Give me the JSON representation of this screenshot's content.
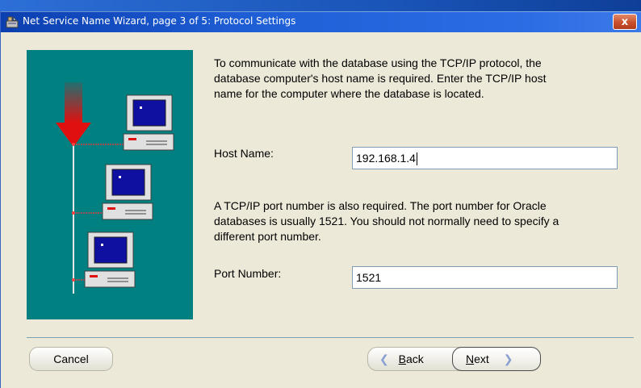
{
  "window": {
    "title": "Net Service Name Wizard, page 3 of 5: Protocol Settings",
    "close_label": "x"
  },
  "intro_text": [
    "To communicate with the database using the TCP/IP protocol, the",
    "database computer's host name is required.  Enter the TCP/IP host",
    "name for the computer where the database is located."
  ],
  "host": {
    "label": "Host Name:",
    "value": "192.168.1.4"
  },
  "port_text": [
    "A TCP/IP port number is also required.  The port number for Oracle",
    "databases is usually 1521.  You should not normally need to specify a",
    "different port number."
  ],
  "port": {
    "label": "Port Number:",
    "value": "1521"
  },
  "buttons": {
    "cancel": "Cancel",
    "back": "Back",
    "back_mnemonic": "B",
    "back_rest": "ack",
    "next": "Next",
    "next_mnemonic": "N",
    "next_rest": "ext"
  },
  "colors": {
    "illustration_bg": "#008080",
    "arrow": "#e01010",
    "titlebar": "#1f5fd6"
  },
  "icons": [
    "wizard-icon",
    "network-computer-icon",
    "red-arrow-icon",
    "back-arrow-icon",
    "next-arrow-icon"
  ]
}
